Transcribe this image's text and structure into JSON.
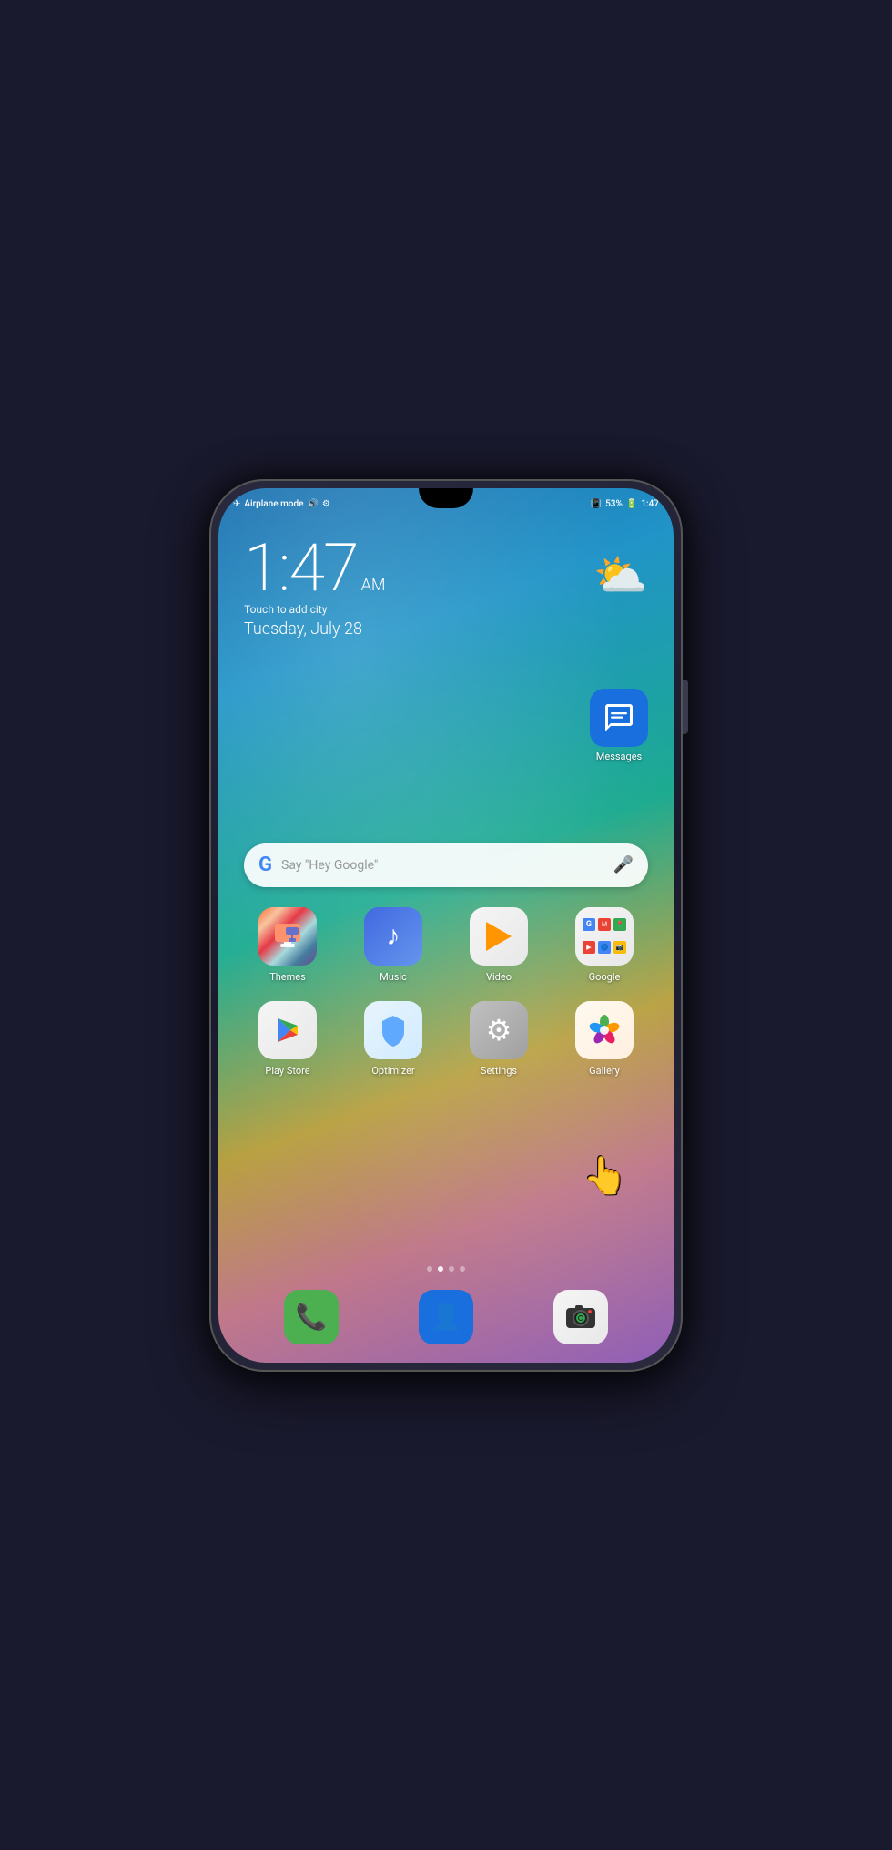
{
  "statusBar": {
    "left": "Airplane mode ✈ 🔊 ⚙",
    "leftText": "Airplane mode",
    "battery": "53%",
    "time": "1:47"
  },
  "clock": {
    "time": "1:47",
    "ampm": "AM",
    "subtitle": "Touch to add city",
    "date": "Tuesday, July 28"
  },
  "searchBar": {
    "placeholder": "Say \"Hey Google\""
  },
  "apps": {
    "row1": [
      {
        "id": "themes",
        "label": "Themes",
        "iconType": "themes"
      },
      {
        "id": "music",
        "label": "Music",
        "iconType": "music"
      },
      {
        "id": "video",
        "label": "Video",
        "iconType": "video"
      },
      {
        "id": "google",
        "label": "Google",
        "iconType": "google"
      }
    ],
    "row2": [
      {
        "id": "playstore",
        "label": "Play Store",
        "iconType": "playstore"
      },
      {
        "id": "optimizer",
        "label": "Optimizer",
        "iconType": "optimizer"
      },
      {
        "id": "settings",
        "label": "Settings",
        "iconType": "settings"
      },
      {
        "id": "gallery",
        "label": "Gallery",
        "iconType": "gallery"
      }
    ],
    "dock": [
      {
        "id": "phone",
        "label": "",
        "iconType": "phone"
      },
      {
        "id": "contacts",
        "label": "",
        "iconType": "contacts"
      },
      {
        "id": "camera",
        "label": "",
        "iconType": "camera"
      }
    ]
  },
  "messages": {
    "label": "Messages"
  },
  "pageIndicators": [
    0,
    1,
    2,
    3
  ]
}
